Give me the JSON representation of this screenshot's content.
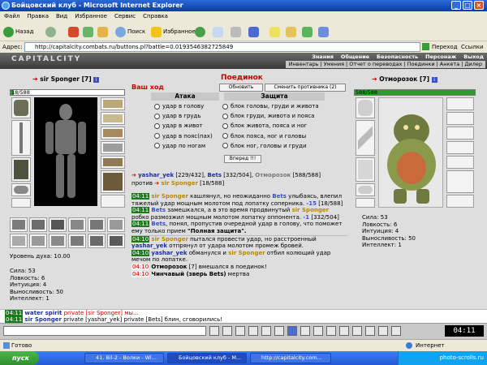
{
  "window": {
    "title": "Бойцовский клуб - Microsoft Internet Explorer"
  },
  "menu": [
    "Файл",
    "Правка",
    "Вид",
    "Избранное",
    "Сервис",
    "Справка"
  ],
  "toolbar": {
    "back": "Назад",
    "search": "Поиск",
    "favorites": "Избранное"
  },
  "address": {
    "label": "Адрес:",
    "url": "http://capitalcity.combats.ru/buttons.pl?battle=0.0193546382725849",
    "go": "Переход",
    "links": "Ссылки"
  },
  "game": {
    "logo": "CAPITALCITY",
    "nav_top": [
      "Знания",
      "Общение",
      "Безопасность",
      "Персонаж",
      "Выход"
    ],
    "nav_bottom": [
      "Инвентарь",
      "Умения",
      "Отчет о переводах",
      "Поединки",
      "Анкета",
      "Дилер"
    ]
  },
  "left_player": {
    "name": "sir Sponger",
    "level": "[7]",
    "hp": "18/588",
    "hp_fraction": 0.03,
    "spirit_label": "Уровень духа:",
    "spirit_value": "10.00",
    "stats": [
      "Сила: 53",
      "Ловкость: 6",
      "Интуиция: 4",
      "Выносливость: 50",
      "Интеллект: 1"
    ]
  },
  "right_player": {
    "name": "Отморозок",
    "level": "[7]",
    "hp": "588/588",
    "hp_fraction": 1.0,
    "stats": [
      "Сила: 53",
      "Ловкость: 6",
      "Интуиция: 4",
      "Выносливость: 50",
      "Интеллект: 1"
    ]
  },
  "battle": {
    "your_move": "Ваш ход",
    "title": "Поединок",
    "refresh_btn": "Обновить",
    "change_btn": "Сменить противника (2)",
    "attack_header": "Атака",
    "defense_header": "Защита",
    "attacks": [
      "удар в голову",
      "удар в грудь",
      "удар в живот",
      "удар в пояс(пах)",
      "удар по ногам"
    ],
    "defenses": [
      "блок головы, груди и живота",
      "блок груди, живота и пояса",
      "блок живота, пояса и ног",
      "блок пояса, ног и головы",
      "блок ног, головы и груди"
    ],
    "forward_btn": "Вперед !!!",
    "team_line_1_name": "yashar_yek",
    "team_line_1_hp": "[229/432],",
    "team_line_1_name2": "Bets",
    "team_line_1_hp2": "[332/504],",
    "team_line_1_name3": "Отморозок",
    "team_line_1_hp3": "[588/588]",
    "team_line_2_prefix": "против",
    "team_line_2_name": "sir Sponger",
    "team_line_2_hp": "[18/588]"
  },
  "log": [
    {
      "time": "04:11",
      "a": "sir Sponger",
      "text1": " кашлянул, но неожиданно ",
      "b": "Bets",
      "text2": " улыбаясь, влепил тяжелый удар мощным молотом под лопатку соперника. ",
      "dmg": "-15",
      "hp": " [18/588]"
    },
    {
      "time": "04:11",
      "a": "Bets",
      "text1": " замешкался, а в это время продвинутый ",
      "b": "sir Sponger",
      "text2": " робко размозжил мощным молотом лопатку оппонента. ",
      "dmg": "-1",
      "hp": " [332/504]"
    },
    {
      "time": "04:11",
      "a": "Bets",
      "text1": ", понял, пропустив очередной удар в голову, что поможет ему только прием ",
      "b": "",
      "text2": "\"Полная защита\".",
      "dmg": "",
      "hp": ""
    },
    {
      "time": "04:10",
      "a": "sir Sponger",
      "text1": " пытался провести удар, но расстроенный ",
      "b": "yashar_yek",
      "text2": " отпрянул от удара молотом промеж бровей.",
      "dmg": "",
      "hp": ""
    },
    {
      "time": "04:10",
      "a": "yashar_yek",
      "text1": " обманулся и ",
      "b": "sir Sponger",
      "text2": " отбил колющий удар мечом по лопатке.",
      "dmg": "",
      "hp": ""
    },
    {
      "time": "04:10",
      "a": "Отморозок",
      "text1": " [7] вмешался в поединок!",
      "b": "",
      "text2": "",
      "dmg": "",
      "hp": ""
    },
    {
      "time": "04:10",
      "a": "Чинчавый (зверь Bets)",
      "text1": " мертва",
      "b": "",
      "text2": "",
      "dmg": "",
      "hp": ""
    }
  ],
  "chat": [
    {
      "time": "04:11",
      "sender": "water spirit",
      "text": " private [sir Sponger] мы..."
    },
    {
      "time": "04:11",
      "sender": "sir Sponger",
      "text": " private [yashar_yek] private [Bets] блин, сговорились!"
    }
  ],
  "gametool": {
    "clock": "04:11"
  },
  "statusbar": {
    "left": "Готово",
    "right": "Интернет"
  },
  "taskbar": {
    "start": "пуск",
    "tasks": [
      "41. Bil-2 - Волки - Wi...",
      "Бойцовский клуб - M...",
      "http://capitalcity.com..."
    ],
    "clock": "photo-scrolls.ru"
  }
}
